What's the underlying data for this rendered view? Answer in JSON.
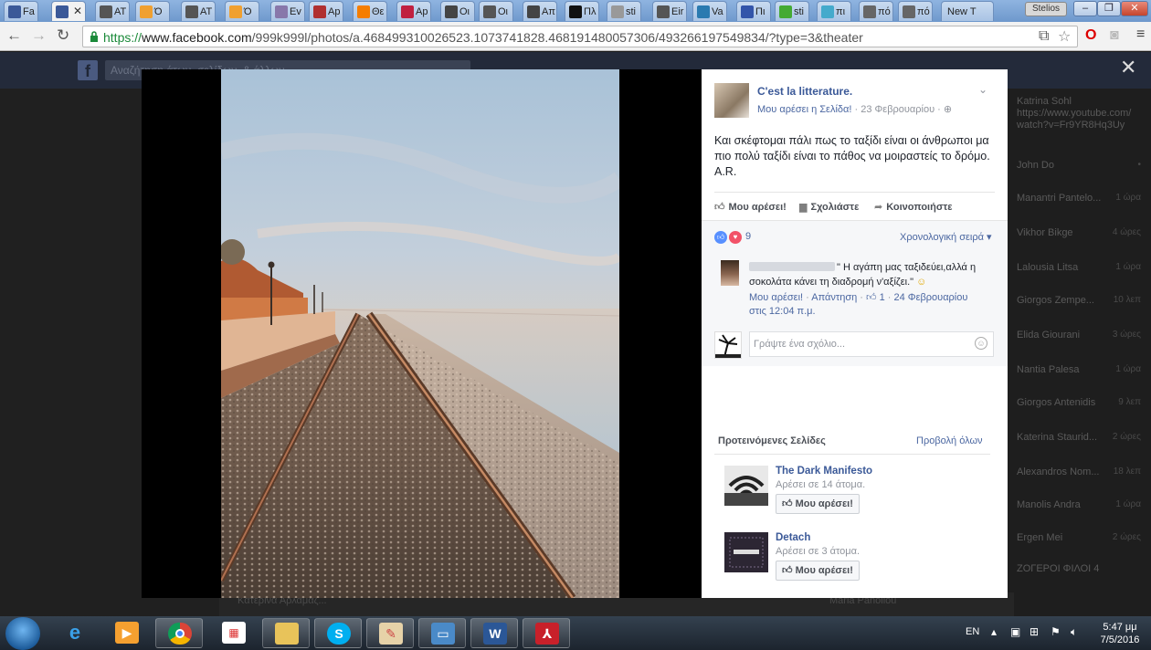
{
  "browser": {
    "tabs": [
      {
        "label": "Fa",
        "favicon": "facebook-icon",
        "color": "#3b5998"
      },
      {
        "label": "",
        "favicon": "facebook-icon",
        "color": "#3b5998",
        "active": true
      },
      {
        "label": "AT",
        "favicon": "radio-icon",
        "color": "#555555"
      },
      {
        "label": "Ό",
        "favicon": "p-icon",
        "color": "#f0a030"
      },
      {
        "label": "AT",
        "favicon": "radio-icon",
        "color": "#555555"
      },
      {
        "label": "Ό",
        "favicon": "p-icon",
        "color": "#f0a030"
      },
      {
        "label": "Ev",
        "favicon": "page-icon",
        "color": "#8877aa"
      },
      {
        "label": "Ap",
        "favicon": "leaf-icon",
        "color": "#b03030"
      },
      {
        "label": "Θε",
        "favicon": "blogger-icon",
        "color": "#f57d00"
      },
      {
        "label": "Ap",
        "favicon": "ball-icon",
        "color": "#c02040"
      },
      {
        "label": "Oι",
        "favicon": "gear-icon",
        "color": "#444444"
      },
      {
        "label": "Oι",
        "favicon": "radio-icon",
        "color": "#555555"
      },
      {
        "label": "Απ",
        "favicon": "gear-icon",
        "color": "#444444"
      },
      {
        "label": "Πλ",
        "favicon": "a-icon",
        "color": "#111111"
      },
      {
        "label": "sti",
        "favicon": "doc-icon",
        "color": "#999999"
      },
      {
        "label": "Eir",
        "favicon": "camera-icon",
        "color": "#555555"
      },
      {
        "label": "Va",
        "favicon": "globe-icon",
        "color": "#2a7ab0"
      },
      {
        "label": "Πι",
        "favicon": "chevrons-icon",
        "color": "#3355aa"
      },
      {
        "label": "sti",
        "favicon": "leaf-icon",
        "color": "#44aa33"
      },
      {
        "label": "πι",
        "favicon": "image-icon",
        "color": "#44aacc"
      },
      {
        "label": "πό",
        "favicon": "wiki-icon",
        "color": "#666666"
      },
      {
        "label": "πό",
        "favicon": "wiki-icon",
        "color": "#666666"
      },
      {
        "label": "New T",
        "favicon": "",
        "color": "#888888"
      }
    ],
    "user_label": "Stelios",
    "url_scheme": "https://",
    "url_host": "www.facebook.com",
    "url_rest": "/999k999l/photos/a.468499310026523.1073741828.468191480057306/493266197549834/?type=3&theater"
  },
  "fb_background": {
    "search_placeholder": "Αναζήτηση άτων, σελίδων, & άλλων",
    "chat_list": [
      {
        "name": "Katrina Sohl",
        "time": ""
      },
      {
        "name": "https://www.youtube.com/",
        "time": ""
      },
      {
        "name": "watch?v=Fr9YR8Hq3Uy",
        "time": ""
      },
      {
        "name": "John Do",
        "time": "•"
      },
      {
        "name": "Manantri Pantelo...",
        "time": "1 ώρα"
      },
      {
        "name": "Vikhor Bikge",
        "time": "4 ώρες"
      },
      {
        "name": "Lalousia Litsa",
        "time": "1 ώρα"
      },
      {
        "name": "Giorgos Zempe...",
        "time": "10 λεπ"
      },
      {
        "name": "Elida Giourani",
        "time": "3 ώρες"
      },
      {
        "name": "Nantia Palesa",
        "time": "1 ώρα"
      },
      {
        "name": "Giorgos Antenidis",
        "time": "9 λεπ"
      },
      {
        "name": "Katerina Staurid...",
        "time": "2 ώρες"
      },
      {
        "name": "Alexandros Nom...",
        "time": "18 λεπ"
      },
      {
        "name": "Manolis Andra",
        "time": "1 ώρα"
      },
      {
        "name": "Ergen Mei",
        "time": "2 ώρες"
      },
      {
        "name": "ΖΟΓΕΡΟΙ ΦΙΛΟΙ 4",
        "time": ""
      }
    ],
    "strip_text": "Κατερινα Αρλαμαζ...",
    "strip_name": "Maria Panoliou"
  },
  "post": {
    "page_name": "C'est la litterature.",
    "liked_label": "Μου αρέσει η Σελίδα!",
    "date": "23 Φεβρουαρίου",
    "body": "Και σκέφτομαι πάλι πως το ταξίδι είναι οι άνθρωποι μα πιο πολύ ταξίδι είναι το πάθος να μοιραστείς το δρόμο. Α.R.",
    "like_action": "Μου αρέσει!",
    "comment_action": "Σχολιάστε",
    "share_action": "Κοινοποιήστε"
  },
  "comments": {
    "reaction_count": "9",
    "sort_label": "Χρονολογική σειρά",
    "comment": {
      "text": "\" Η αγάπη μας ταξιδεύει,αλλά η σοκολάτα κάνει τη διαδρομή ν'αξίζει.\"",
      "like_link": "Μου αρέσει!",
      "reply_link": "Απάντηση",
      "like_count": "1",
      "date": "24 Φεβρουαρίου",
      "time": "στις 12:04 π.μ."
    },
    "input_placeholder": "Γράψτε ένα σχόλιο..."
  },
  "suggested": {
    "title": "Προτεινόμενες Σελίδες",
    "see_all": "Προβολή όλων",
    "items": [
      {
        "name": "The Dark Manifesto",
        "count": "Αρέσει σε 14 άτομα.",
        "button": "Μου αρέσει!"
      },
      {
        "name": "Detach",
        "count": "Αρέσει σε 3 άτομα.",
        "button": "Μου αρέσει!"
      }
    ]
  },
  "taskbar": {
    "apps": [
      "Internet Explorer",
      "Media Player",
      "Chrome",
      "Apps",
      "Explorer",
      "Skype",
      "Paint",
      "Photos",
      "Word",
      "Acrobat"
    ],
    "lang": "EN",
    "time": "5:47 μμ",
    "date": "7/5/2016"
  }
}
